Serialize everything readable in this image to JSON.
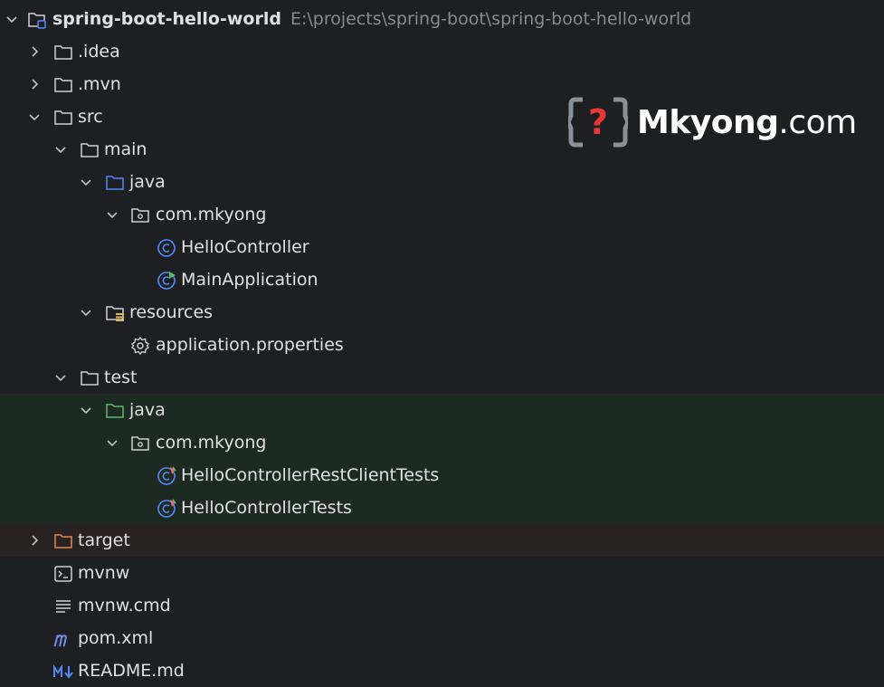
{
  "project": {
    "name": "spring-boot-hello-world",
    "path": "E:\\projects\\spring-boot\\spring-boot-hello-world"
  },
  "tree": {
    "idea": ".idea",
    "mvn": ".mvn",
    "src": "src",
    "main": "main",
    "main_java": "java",
    "main_pkg": "com.mkyong",
    "hello_controller": "HelloController",
    "main_application": "MainApplication",
    "resources": "resources",
    "app_properties": "application.properties",
    "test": "test",
    "test_java": "java",
    "test_pkg": "com.mkyong",
    "rest_client_tests": "HelloControllerRestClientTests",
    "controller_tests": "HelloControllerTests",
    "target": "target",
    "mvnw": "mvnw",
    "mvnw_cmd": "mvnw.cmd",
    "pom": "pom.xml",
    "readme": "README.md"
  },
  "watermark": {
    "brand": "Mkyong",
    "suffix": ".com"
  },
  "colors": {
    "background": "#1e1f22",
    "test_highlight": "#1d2a22",
    "excluded_highlight": "#2a2222",
    "class_icon": "#548af7",
    "test_folder": "#5fb865",
    "target_folder": "#e08855"
  },
  "icons": {
    "chevron_expanded": "chevron-down-icon",
    "chevron_collapsed": "chevron-right-icon",
    "folder": "folder-icon",
    "source_root": "source-folder-icon",
    "package": "package-icon",
    "class": "class-icon",
    "resources": "resources-folder-icon",
    "properties": "gear-icon",
    "excluded": "excluded-folder-icon",
    "terminal": "terminal-icon",
    "text_file": "text-file-icon",
    "maven": "maven-icon",
    "markdown": "markdown-icon"
  }
}
